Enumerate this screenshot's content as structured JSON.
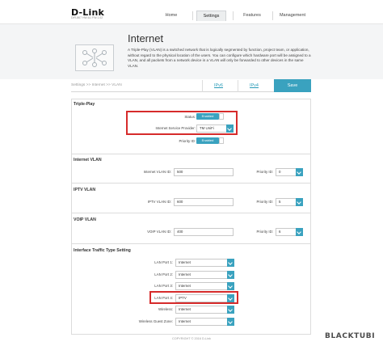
{
  "header": {
    "brand": "D-Link",
    "model": "DIR-867 HW:A1 FW:1.02",
    "nav": [
      {
        "label": "Home"
      },
      {
        "label": "Settings"
      },
      {
        "label": "Features"
      },
      {
        "label": "Management"
      }
    ],
    "active_nav": "Settings"
  },
  "hero": {
    "title": "Internet",
    "description": "A Triple-Play (VLAN) is a switched network that is logically segmented by function, project team, or application, without regard to the physical location of the users. You can configure which hardware port will be assigned to a VLAN, and all packets from a network device in a VLAN will only be forwarded to other devices in the same VLAN."
  },
  "breadcrumb": "Settings >> Internet >> VLAN",
  "subtabs": [
    {
      "label": "IPv6"
    },
    {
      "label": "IPv4"
    }
  ],
  "save_label": "Save",
  "triple_play": {
    "title": "Triple-Play",
    "status_label": "Status:",
    "status_value": "Enabled",
    "isp_label": "Internet Service Provider:",
    "isp_value": "TM UniFi",
    "priority_label": "Priority ID:",
    "priority_value": "Enabled"
  },
  "internet_vlan": {
    "title": "Internet VLAN",
    "vlan_label": "Internet VLAN ID:",
    "vlan_value": "500",
    "priority_label": "Priority ID:",
    "priority_value": "0"
  },
  "iptv_vlan": {
    "title": "IPTV VLAN",
    "vlan_label": "IPTV VLAN ID:",
    "vlan_value": "600",
    "priority_label": "Priority ID:",
    "priority_value": "5"
  },
  "voip_vlan": {
    "title": "VOIP VLAN",
    "vlan_label": "VOIP VLAN ID:",
    "vlan_value": "400",
    "priority_label": "Priority ID:",
    "priority_value": "6"
  },
  "traffic": {
    "title": "Interface Traffic Type Setting",
    "rows": [
      {
        "label": "LAN Port 1:",
        "value": "Internet"
      },
      {
        "label": "LAN Port 2:",
        "value": "Internet"
      },
      {
        "label": "LAN Port 3:",
        "value": "Internet"
      },
      {
        "label": "LAN Port 4:",
        "value": "IPTV"
      },
      {
        "label": "Wireless:",
        "value": "Internet"
      },
      {
        "label": "Wireless Guest Zone:",
        "value": "Internet"
      }
    ]
  },
  "footer": "COPYRIGHT © 2016 D-Link",
  "watermark": "BLACKTUBI",
  "colors": {
    "accent": "#3aa2bf",
    "highlight": "#d62b2b"
  }
}
